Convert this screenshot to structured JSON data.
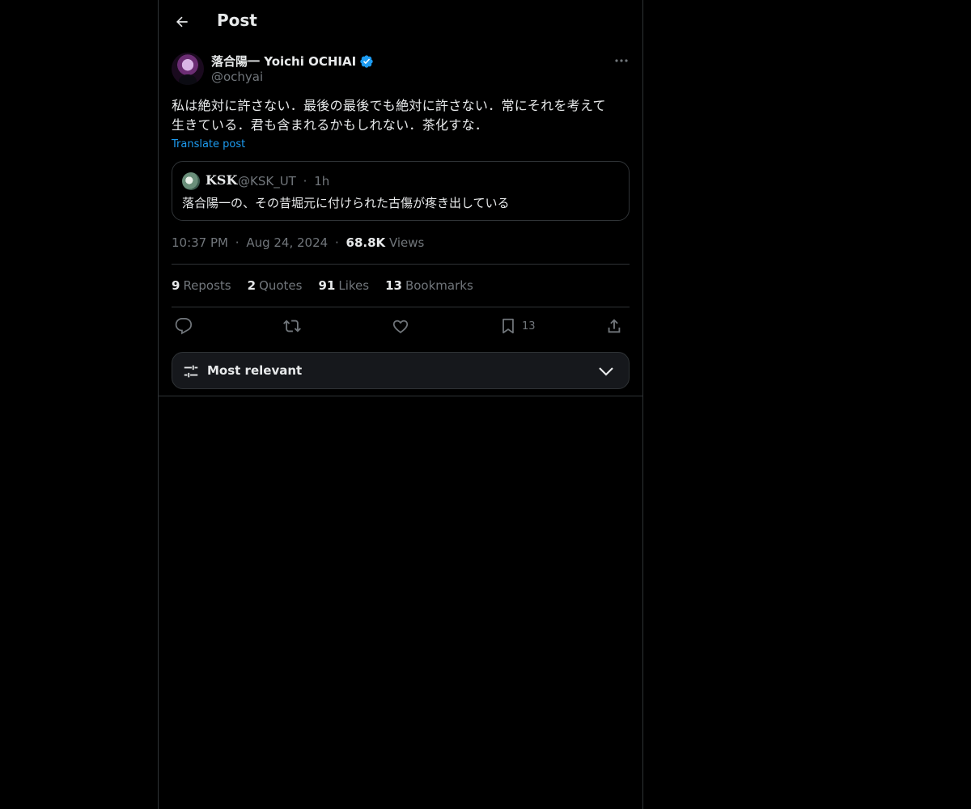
{
  "header": {
    "title": "Post"
  },
  "post": {
    "author_name": "落合陽一 Yoichi OCHIAI",
    "author_handle": "@ochyai",
    "text_line1": "私は絶対に許さない．最後の最後でも絶対に許さない．常にそれを考えて",
    "text_line2": "生きている．君も含まれるかもしれない．茶化すな．",
    "translate_label": "Translate post",
    "quote": {
      "name": "KSK",
      "handle": "@KSK_UT",
      "sep": "·",
      "time": "1h",
      "text": "落合陽一の、その昔堀元に付けられた古傷が疼き出している"
    },
    "time": "10:37 PM",
    "date": "Aug 24, 2024",
    "dot": "·",
    "views_count": "68.8K",
    "views_label": "Views",
    "stats": {
      "reposts_count": "9",
      "reposts_label": "Reposts",
      "quotes_count": "2",
      "quotes_label": "Quotes",
      "likes_count": "91",
      "likes_label": "Likes",
      "bookmarks_count": "13",
      "bookmarks_label": "Bookmarks"
    },
    "actions": {
      "bookmark_count": "13"
    }
  },
  "replies_sort": {
    "label": "Most relevant"
  },
  "colors": {
    "background": "#000000",
    "text": "#e7e9ea",
    "muted": "#71767b",
    "accent": "#1d9bf0",
    "border": "#2f3336"
  },
  "icons": [
    "back-arrow-icon",
    "verified-badge-icon",
    "more-icon",
    "reply-icon",
    "repost-icon",
    "like-icon",
    "bookmark-icon",
    "share-icon",
    "filter-icon",
    "chevron-down-icon"
  ]
}
